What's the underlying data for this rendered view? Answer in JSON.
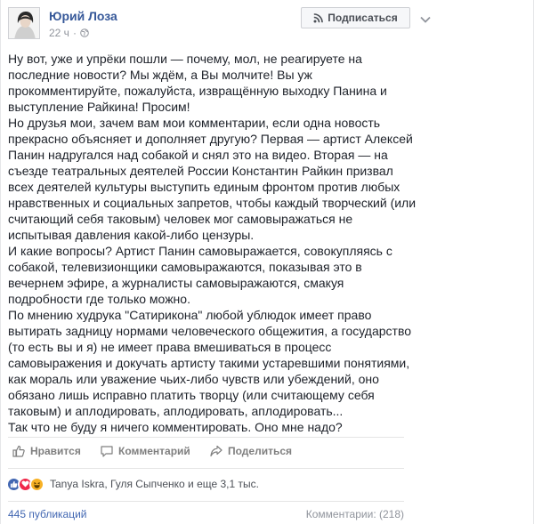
{
  "post": {
    "author": "Юрий Лоза",
    "time": "22 ч",
    "subscribe_label": "Подписаться",
    "paragraphs": [
      "Ну вот, уже и упрёки пошли — почему, мол, не реагируете на последние новости? Мы ждём, а Вы молчите! Вы уж прокомментируйте, пожалуйста, извращённую выходку Панина и выступление Райкина! Просим!",
      "Но друзья мои, зачем вам мои комментарии, если одна новость прекрасно объясняет и дополняет другую? Первая — артист Алексей Панин надругался над собакой и снял это на видео. Вторая — на съезде театральных деятелей России Константин Райкин призвал всех деятелей культуры выступить единым фронтом против любых нравственных и социальных запретов, чтобы каждый творческий (или считающий себя таковым) человек мог самовыражаться не испытывая давления какой-либо цензуры.",
      "И какие вопросы? Артист Панин самовыражается, совокупляясь с собакой, телевизионщики самовыражаются, показывая это в вечернем эфире, а журналисты самовыражаются, смакуя подробности где только можно.",
      "По мнению худрука \"Сатирикона\" любой ублюдок имеет право вытирать задницу нормами человеческого общежития, а государство (то есть вы и я) не имеет права вмешиваться в процесс самовыражения и докучать артисту такими устаревшими понятиями, как мораль или уважение чьих-либо чувств или убеждений, оно обязано лишь исправно платить творцу (или считающему себя таковым) и аплодировать, аплодировать, аплодировать...",
      "Так что не буду я ничего комментировать. Оно мне надо?"
    ]
  },
  "actions": {
    "like": "Нравится",
    "comment": "Комментарий",
    "share": "Поделиться"
  },
  "reactions": {
    "names": "Tanya Iskra, Гуля Сыпченко и еще 3,1 тыс."
  },
  "footer": {
    "shares": "445 публикаций",
    "comments": "Комментарии: (218)"
  }
}
